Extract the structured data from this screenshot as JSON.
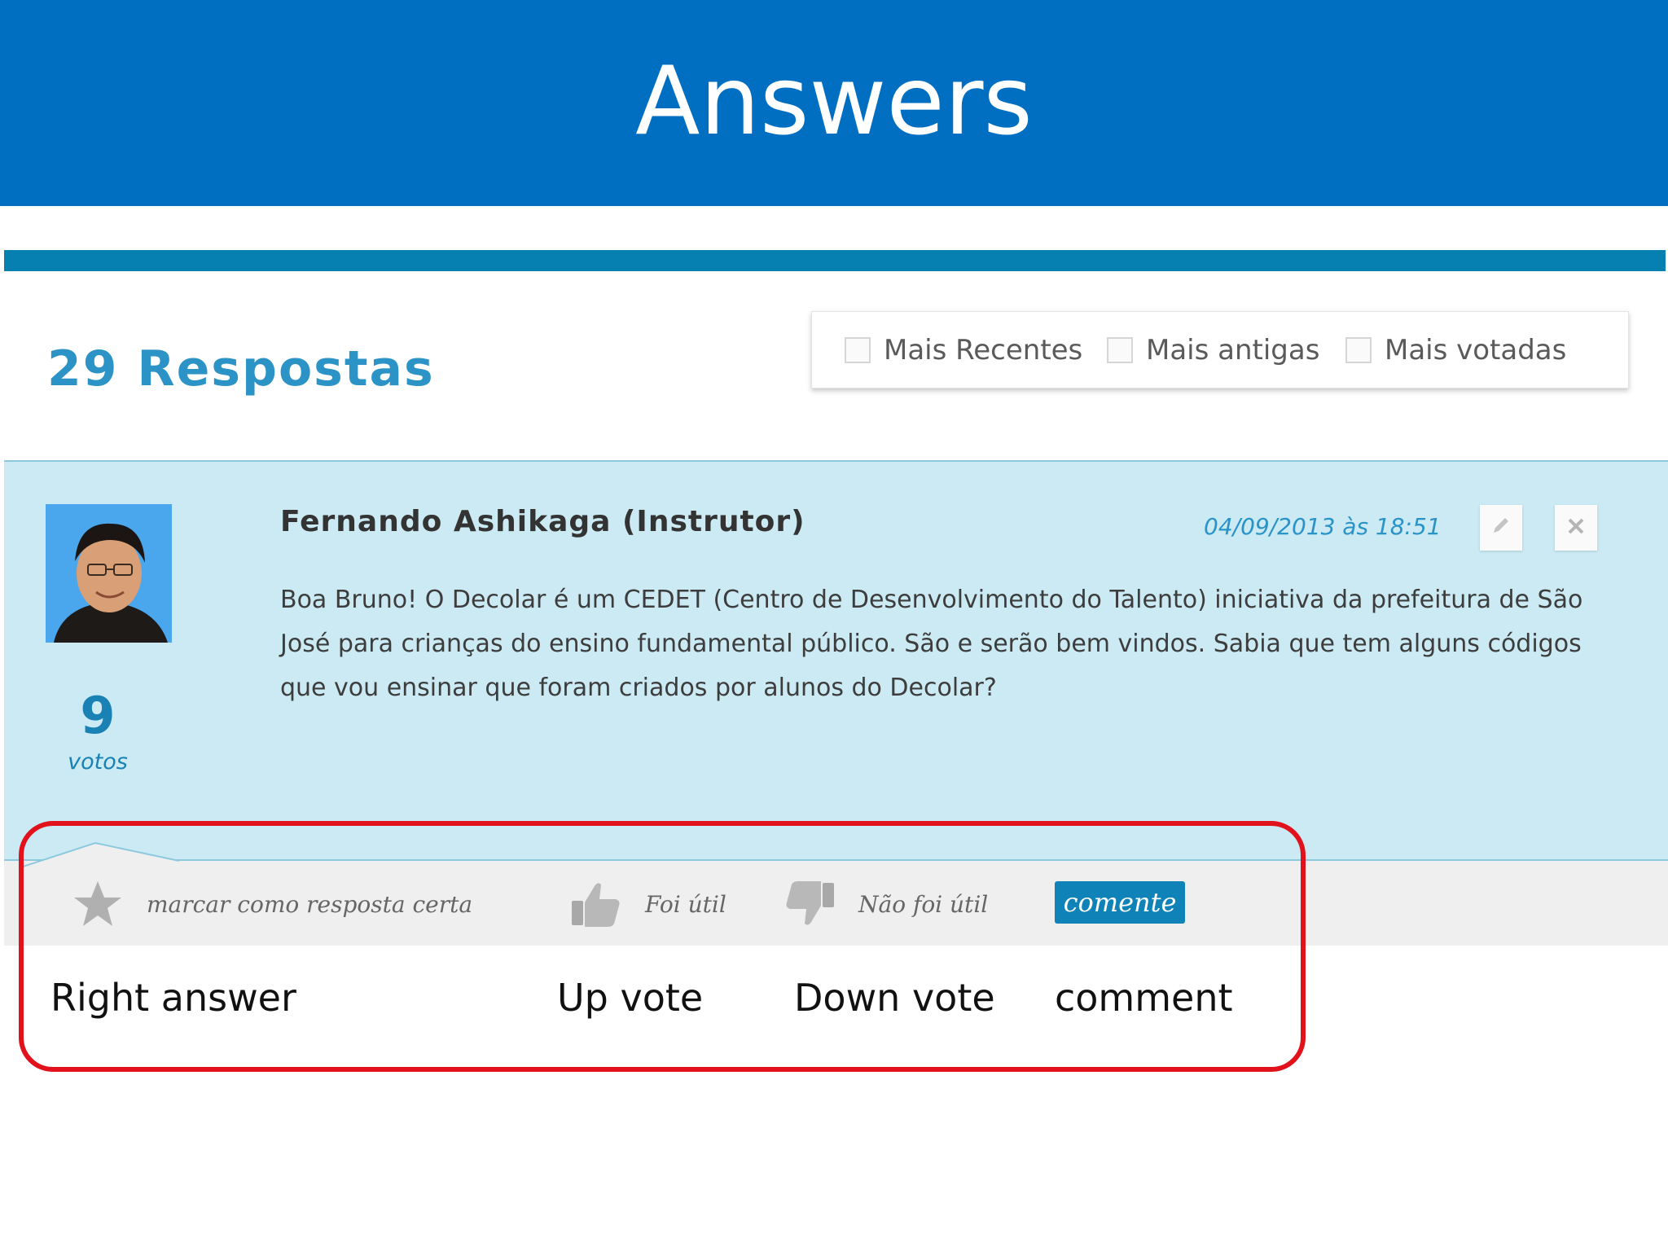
{
  "slide": {
    "title": "Answers"
  },
  "header": {
    "count_label": "29 Respostas"
  },
  "filters": [
    {
      "label": "Mais Recentes",
      "checked": false
    },
    {
      "label": "Mais antigas",
      "checked": false
    },
    {
      "label": "Mais votadas",
      "checked": false
    }
  ],
  "answer": {
    "author": "Fernando Ashikaga (Instrutor)",
    "date": "04/09/2013 às 18:51",
    "votes": "9",
    "votes_label": "votos",
    "body": "Boa Bruno! O Decolar é um CEDET (Centro de Desenvolvimento do Talento) iniciativa da prefeitura de São José para crianças do ensino fundamental público. São e serão bem vindos. Sabia que tem alguns códigos que vou ensinar que foram criados por alunos do Decolar?",
    "tools": {
      "edit_icon": "pencil-icon",
      "delete_icon": "close-icon"
    }
  },
  "actions": {
    "mark_correct": "marcar como resposta certa",
    "useful": "Foi útil",
    "not_useful": "Não foi útil",
    "comment": "comente"
  },
  "annotations": {
    "right_answer": "Right answer",
    "up_vote": "Up vote",
    "down_vote": "Down vote",
    "comment": "comment"
  },
  "colors": {
    "header_bg": "#006fc2",
    "accent": "#0580b0",
    "panel_bg": "#cbeaf3",
    "highlight": "#e2121c"
  }
}
